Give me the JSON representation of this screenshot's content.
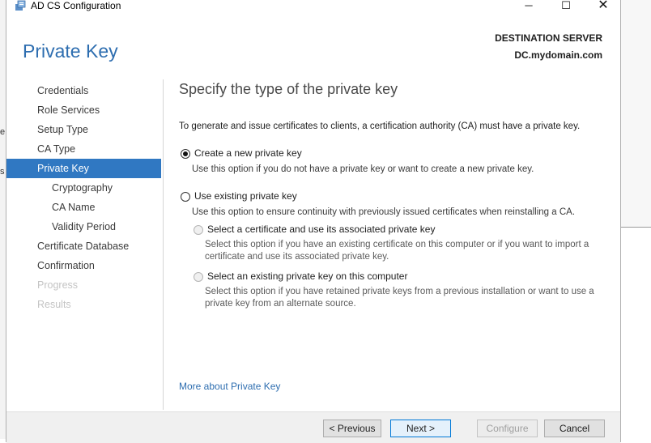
{
  "window": {
    "title": "AD CS Configuration",
    "minimize": "─",
    "maximize": "☐",
    "close": "✕"
  },
  "background": {
    "chars": [
      "e",
      "s"
    ]
  },
  "header": {
    "page_title": "Private Key",
    "destination_label": "DESTINATION SERVER",
    "destination_server": "DC.mydomain.com"
  },
  "nav": {
    "items": [
      {
        "label": "Credentials",
        "state": "normal"
      },
      {
        "label": "Role Services",
        "state": "normal"
      },
      {
        "label": "Setup Type",
        "state": "normal"
      },
      {
        "label": "CA Type",
        "state": "normal"
      },
      {
        "label": "Private Key",
        "state": "active"
      },
      {
        "label": "Cryptography",
        "state": "normal"
      },
      {
        "label": "CA Name",
        "state": "normal"
      },
      {
        "label": "Validity Period",
        "state": "normal"
      },
      {
        "label": "Certificate Database",
        "state": "normal"
      },
      {
        "label": "Confirmation",
        "state": "normal"
      },
      {
        "label": "Progress",
        "state": "disabled"
      },
      {
        "label": "Results",
        "state": "disabled"
      }
    ]
  },
  "content": {
    "title": "Specify the type of the private key",
    "intro": "To generate and issue certificates to clients, a certification authority (CA) must have a private key.",
    "option_new": {
      "label": "Create a new private key",
      "desc": "Use this option if you do not have a private key or want to create a new private key.",
      "checked": true
    },
    "option_existing": {
      "label": "Use existing private key",
      "desc": "Use this option to ensure continuity with previously issued certificates when reinstalling a CA.",
      "checked": false
    },
    "sub_cert": {
      "label": "Select a certificate and use its associated private key",
      "desc": "Select this option if you have an existing certificate on this computer or if you want to import a certificate and use its associated private key."
    },
    "sub_key": {
      "label": "Select an existing private key on this computer",
      "desc": "Select this option if you have retained private keys from a previous installation or want to use a private key from an alternate source."
    },
    "more_link": "More about Private Key"
  },
  "footer": {
    "previous": "< Previous",
    "next": "Next >",
    "configure": "Configure",
    "cancel": "Cancel"
  }
}
